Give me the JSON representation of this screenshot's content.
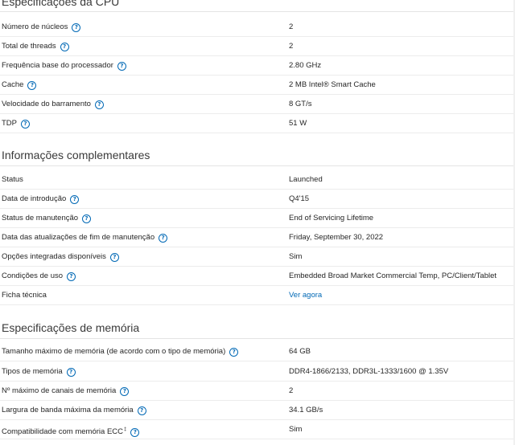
{
  "sections": {
    "cpu": {
      "title": "Especificações da CPU",
      "rows": [
        {
          "label": "Número de núcleos",
          "value": "2"
        },
        {
          "label": "Total de threads",
          "value": "2"
        },
        {
          "label": "Frequência base do processador",
          "value": "2.80 GHz"
        },
        {
          "label": "Cache",
          "value": "2 MB Intel® Smart Cache"
        },
        {
          "label": "Velocidade do barramento",
          "value": "8 GT/s"
        },
        {
          "label": "TDP",
          "value": "51 W"
        }
      ]
    },
    "supplemental": {
      "title": "Informações complementares",
      "rows": [
        {
          "label": "Status",
          "value": "Launched"
        },
        {
          "label": "Data de introdução",
          "value": "Q4'15"
        },
        {
          "label": "Status de manutenção",
          "value": "End of Servicing Lifetime"
        },
        {
          "label": "Data das atualizações de fim de manutenção",
          "value": "Friday, September 30, 2022"
        },
        {
          "label": "Opções integradas disponíveis",
          "value": "Sim"
        },
        {
          "label": "Condições de uso",
          "value": "Embedded Broad Market Commercial Temp, PC/Client/Tablet"
        },
        {
          "label": "Ficha técnica",
          "value": "Ver agora"
        }
      ]
    },
    "memory": {
      "title": "Especificações de memória",
      "rows": [
        {
          "label": "Tamanho máximo de memória (de acordo com o tipo de memória)",
          "value": "64 GB"
        },
        {
          "label": "Tipos de memória",
          "value": "DDR4-1866/2133, DDR3L-1333/1600 @ 1.35V"
        },
        {
          "label": "Nº máximo de canais de memória",
          "value": "2"
        },
        {
          "label": "Largura de banda máxima da memória",
          "value": "34.1 GB/s"
        },
        {
          "label": "Compatibilidade com memória ECC",
          "label_sup": "‡",
          "value": "Sim"
        }
      ]
    }
  },
  "help_icon": {
    "name": "help-question-icon",
    "glyph": "?",
    "color": "#0068b5"
  },
  "link_color": "#0068b5"
}
